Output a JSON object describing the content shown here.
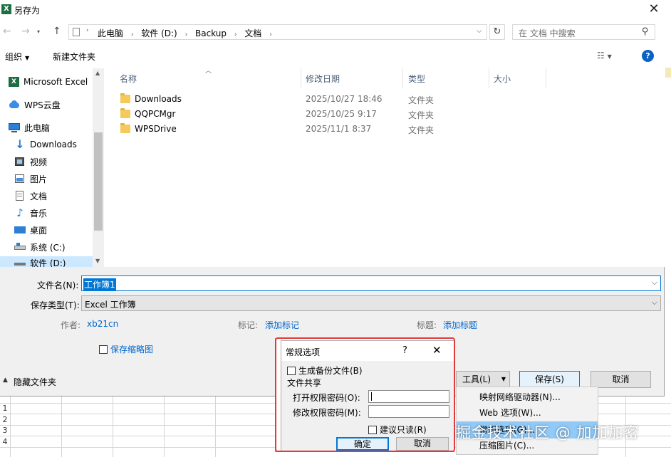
{
  "window": {
    "title": "另存为"
  },
  "nav": {
    "breadcrumb": [
      "此电脑",
      "软件 (D:)",
      "Backup",
      "文档"
    ],
    "search_placeholder": "在 文档 中搜索"
  },
  "toolbar": {
    "organize": "组织",
    "new_folder": "新建文件夹"
  },
  "tree": {
    "items": [
      "Microsoft Excel",
      "WPS云盘",
      "此电脑",
      "Downloads",
      "视频",
      "图片",
      "文档",
      "音乐",
      "桌面",
      "系统 (C:)",
      "软件 (D:)"
    ]
  },
  "list": {
    "columns": [
      "名称",
      "修改日期",
      "类型",
      "大小"
    ],
    "rows": [
      {
        "name": "Downloads",
        "date": "2025/10/27 18:46",
        "type": "文件夹"
      },
      {
        "name": "QQPCMgr",
        "date": "2025/10/25 9:17",
        "type": "文件夹"
      },
      {
        "name": "WPSDrive",
        "date": "2025/11/1 8:37",
        "type": "文件夹"
      }
    ]
  },
  "form": {
    "filename_label": "文件名(N):",
    "filename_value": "工作簿1",
    "filetype_label": "保存类型(T):",
    "filetype_value": "Excel 工作簿",
    "author_label": "作者:",
    "author_value": "xb21cn",
    "tags_label": "标记:",
    "tags_value": "添加标记",
    "title_label": "标题:",
    "title_value": "添加标题",
    "thumbnail_label": "保存缩略图"
  },
  "footer": {
    "hide_folders": "隐藏文件夹",
    "tools": "工具(L)",
    "save": "保存(S)",
    "cancel": "取消"
  },
  "options_dialog": {
    "title": "常规选项",
    "help": "?",
    "backup": "生成备份文件(B)",
    "share_section": "文件共享",
    "open_pwd": "打开权限密码(O):",
    "modify_pwd": "修改权限密码(M):",
    "readonly": "建议只读(R)",
    "ok": "确定",
    "cancel": "取消"
  },
  "tools_menu": {
    "items": [
      "映射网络驱动器(N)...",
      "Web 选项(W)...",
      "常规选项(G)...",
      "压缩图片(C)..."
    ]
  },
  "sheet_rows": [
    "1",
    "2",
    "3",
    "4"
  ],
  "watermark": "掘金技术社区 @ 加加加密",
  "colors": {
    "accent": "#0078d7",
    "highlight": "#cce8ff",
    "folder": "#f5c95c",
    "excel_green": "#1d6f42"
  }
}
